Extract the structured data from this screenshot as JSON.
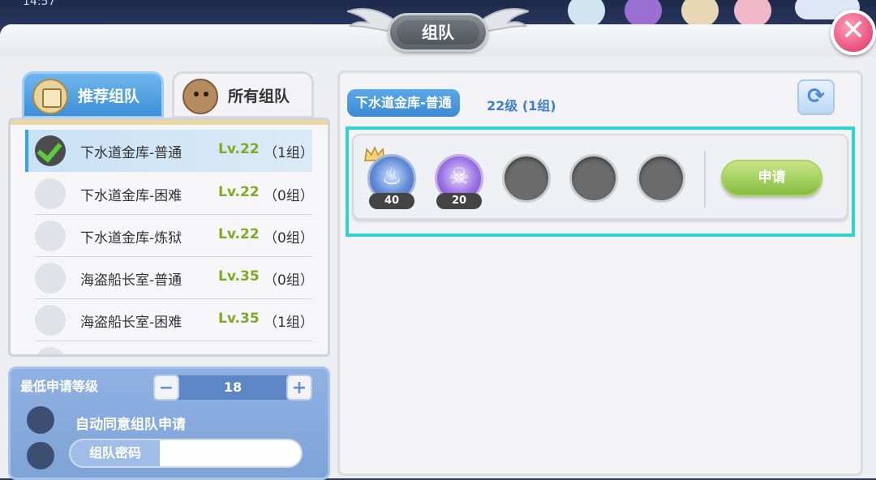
{
  "hud": {
    "clock": "14:57"
  },
  "window": {
    "title": "组队",
    "close_icon": "close-icon"
  },
  "tabs": [
    {
      "label": "推荐组队",
      "icon": "scroll-icon",
      "active": true
    },
    {
      "label": "所有组队",
      "icon": "creature-icon",
      "active": false
    }
  ],
  "dungeons": [
    {
      "name": "下水道金库-普通",
      "level": "Lv.22",
      "count": "（1组）",
      "selected": true
    },
    {
      "name": "下水道金库-困难",
      "level": "Lv.22",
      "count": "（0组）",
      "selected": false
    },
    {
      "name": "下水道金库-炼狱",
      "level": "Lv.22",
      "count": "（0组）",
      "selected": false
    },
    {
      "name": "海盗船长室-普通",
      "level": "Lv.35",
      "count": "（0组）",
      "selected": false
    },
    {
      "name": "海盗船长室-困难",
      "level": "Lv.35",
      "count": "（1组）",
      "selected": false
    }
  ],
  "settings": {
    "min_level_label": "最低申请等级",
    "min_level_value": "18",
    "minus": "−",
    "plus": "+",
    "auto_accept_label": "自动同意组队申请",
    "password_label": "组队密码",
    "password_value": ""
  },
  "team_panel": {
    "dungeon": "下水道金库-普通",
    "info": "22级 (1组)",
    "refresh_icon": "refresh-icon",
    "members": [
      {
        "type": "mage",
        "level": "40",
        "leader": true
      },
      {
        "type": "skull",
        "level": "20",
        "leader": false
      },
      {
        "type": "empty"
      },
      {
        "type": "empty"
      },
      {
        "type": "empty"
      }
    ],
    "apply_label": "申请"
  },
  "colors": {
    "accent_blue": "#3c8ad4",
    "level_green": "#7dab22",
    "highlight_cyan": "#2fd3d0",
    "apply_green": "#86bd3f"
  }
}
